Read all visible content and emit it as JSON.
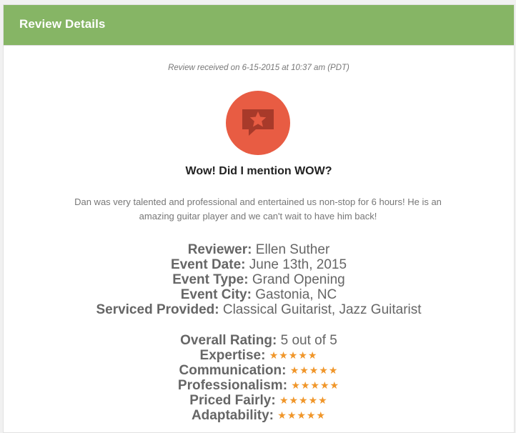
{
  "header": {
    "title": "Review Details"
  },
  "received_text": "Review received on 6-15-2015 at 10:37 am (PDT)",
  "badge": {
    "icon": "star-speech-bubble-icon",
    "color": "#e85c43"
  },
  "review": {
    "title": "Wow! Did I mention WOW?",
    "body": "Dan was very talented and professional and entertained us non-stop for 6 hours! He is an amazing guitar player and we can't wait to have him back!"
  },
  "details": [
    {
      "label": "Reviewer:",
      "value": "Ellen Suther"
    },
    {
      "label": "Event Date:",
      "value": "June 13th, 2015"
    },
    {
      "label": "Event Type:",
      "value": "Grand Opening"
    },
    {
      "label": "Event City:",
      "value": "Gastonia, NC"
    },
    {
      "label": "Serviced Provided:",
      "value": "Classical Guitarist, Jazz Guitarist"
    }
  ],
  "overall": {
    "label": "Overall Rating:",
    "value": "5 out of 5"
  },
  "ratings": [
    {
      "label": "Expertise:",
      "stars": "★★★★★",
      "score": 5
    },
    {
      "label": "Communication:",
      "stars": "★★★★★",
      "score": 5
    },
    {
      "label": "Professionalism:",
      "stars": "★★★★★",
      "score": 5
    },
    {
      "label": "Priced Fairly:",
      "stars": "★★★★★",
      "score": 5
    },
    {
      "label": "Adaptability:",
      "stars": "★★★★★",
      "score": 5
    }
  ],
  "colors": {
    "header": "#86b565",
    "star": "#f0962a"
  }
}
